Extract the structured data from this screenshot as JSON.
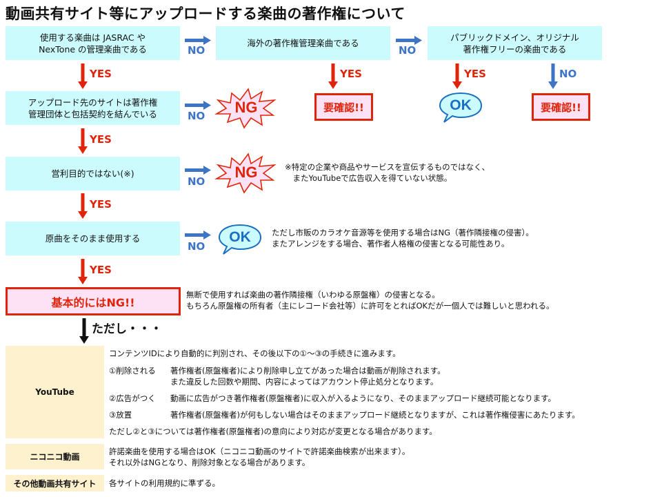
{
  "title": "動画共有サイト等にアップロードする楽曲の著作権について",
  "labels": {
    "yes": "YES",
    "no": "NO",
    "however": "ただし・・・"
  },
  "colors": {
    "question_bg": "#ccfbfd",
    "ng_border": "#e0240a",
    "ng_fill": "#fde2f6",
    "no_arrow": "#3e74c6",
    "yes_arrow": "#e0240a",
    "ok_border": "#1a6fc0",
    "site_bg": "#fdf1ce"
  },
  "questions": {
    "q1": {
      "line1": "使用する楽曲は JASRAC や",
      "line2": "NexTone の管理楽曲である"
    },
    "q2": {
      "line1": "海外の著作権管理楽曲である"
    },
    "q3": {
      "line1": "パブリックドメイン、オリジナル",
      "line2": "著作権フリーの楽曲である"
    },
    "q4": {
      "line1": "アップロード先のサイトは著作権",
      "line2": "管理団体と包括契約を結んでいる"
    },
    "q5": {
      "line1": "営利目的ではない(※)"
    },
    "q6": {
      "line1": "原曲をそのまま使用する"
    }
  },
  "results": {
    "confirm": "要確認!!",
    "ng": "NG",
    "ok": "OK",
    "basically_ng": "基本的にはNG!!"
  },
  "notes": {
    "commercial": {
      "line1": "※特定の企業や商品やサービスを宣伝するものではなく、",
      "line2": "　またYouTubeで広告収入を得ていない状態。"
    },
    "original": {
      "line1": "ただし市販のカラオケ音源等を使用する場合はNG（著作隣接権の侵害）。",
      "line2": "またアレンジをする場合、著作者人格権の侵害となる可能性あり。"
    },
    "basically_ng": {
      "line1": "無断で使用すれば楽曲の著作隣接権（いわゆる原盤権）の侵害となる。",
      "line2": "もちろん原盤権の所有者（主にレコード会社等）に許可をとればOKだが一個人では難しいと思われる。"
    }
  },
  "sites": [
    {
      "name": "YouTube",
      "intro": "コンテンツIDにより自動的に判別され、その後以下の①～③の手続きに進みます。",
      "items": [
        {
          "label": "①削除される",
          "text": "著作権者(原盤権者)により削除申し立てがあった場合は動画が削除されます。",
          "text2": "また違反した回数や期間、内容によってはアカウント停止処分となります。"
        },
        {
          "label": "②広告がつく",
          "text": "動画に広告がつき著作権者(原盤権者)に収入が入るようになり、そのままアップロード継続可能となります。"
        },
        {
          "label": "③放置",
          "text": "著作権者(原盤権者)が何もしない場合はそのままアップロード継続となりますが、これは著作権侵害にあたります。"
        }
      ],
      "footer": "ただし②と③については著作権者(原盤権者)の意向により対応が変更となる場合があります。"
    },
    {
      "name": "ニコニコ動画",
      "line1": "許諾楽曲を使用する場合はOK（ニコニコ動画のサイトで許諾楽曲検索が出来ます）。",
      "line2": "それ以外はNGとなり、削除対象となる場合があります。"
    },
    {
      "name": "その他動画共有サイト",
      "line1": "各サイトの利用規約に準ずる。"
    }
  ]
}
